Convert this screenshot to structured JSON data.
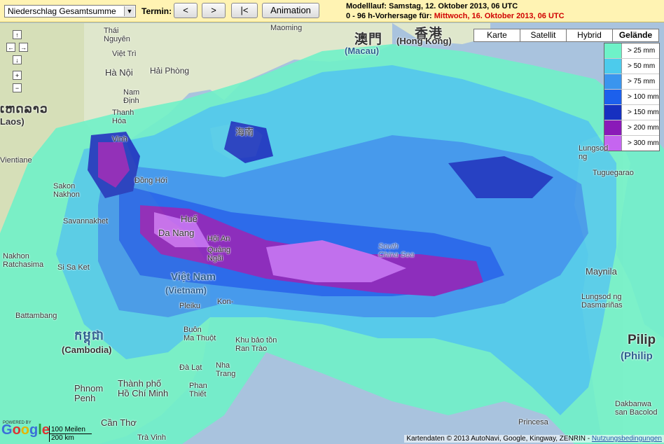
{
  "toolbar": {
    "select_value": "Niederschlag Gesamtsumme",
    "termin_label": "Termin:",
    "btn_prev": "<",
    "btn_next": ">",
    "btn_first": "|<",
    "btn_animation": "Animation",
    "model_run": "Modelllauf: Samstag, 12. Oktober 2013, 06 UTC",
    "forecast_prefix": "0 - 96 h-Vorhersage für: ",
    "forecast_date": "Mittwoch, 16. Oktober 2013, 06 UTC"
  },
  "map_types": [
    "Karte",
    "Satellit",
    "Hybrid",
    "Gelände"
  ],
  "legend": [
    {
      "label": "> 25 mm",
      "color": "#6ef2c8"
    },
    {
      "label": "> 50 mm",
      "color": "#4ccbec"
    },
    {
      "label": "> 75 mm",
      "color": "#3a95ee"
    },
    {
      "label": "> 100 mm",
      "color": "#1c60ec"
    },
    {
      "label": "> 150 mm",
      "color": "#1630c0"
    },
    {
      "label": "> 200 mm",
      "color": "#8a1ab8"
    },
    {
      "label": "> 300 mm",
      "color": "#c565f0"
    }
  ],
  "places": {
    "thai_nguyen": "Thái\nNguyên",
    "viet_tri": "Việt Trì",
    "ha_noi": "Hà Nội",
    "hai_phong": "Hải Phòng",
    "nam_dinh": "Nam\nĐịnh",
    "thanh_hoa": "Thanh\nHóa",
    "vinh": "Vinh",
    "dong_hoi": "Đồng Hới",
    "hue": "Huế",
    "da_nang": "Da Nang",
    "hoi_an": "Hội An",
    "quang_ngai": "Quảng\nNgãi",
    "kon_tum": "Kon-",
    "pleiku": "Pleiku",
    "buon_ma_thuot": "Buôn\nMa Thuột",
    "khu_bao_ton": "Khu bảo tồn\nRan Trào",
    "nha_trang": "Nha\nTrang",
    "da_lat": "Đà Lạt",
    "phan_thiet": "Phan\nThiết",
    "ho_chi_minh": "Thành phố\nHồ Chí Minh",
    "can_tho": "Cần Thơ",
    "tra_vinh": "Trà Vinh",
    "phnom_penh": "Phnom\nPenh",
    "battambang": "Battambang",
    "vientiane": "Vientiane",
    "sakon_nakhon": "Sakon\nNakhon",
    "savannakhet": "Savannakhet",
    "nakhon": "Nakhon\nRatchasima",
    "sisaket": "Si Sa Ket",
    "maoming": "Maoming",
    "macau_cn": "澳門",
    "macau": "(Macau)",
    "hongkong_cn": "香港",
    "hongkong": "(Hong Kong)",
    "hainan_cn": "海南",
    "south_china_sea": "South\nChina Sea",
    "lungsod": "Lungsod\nng",
    "tuguegarao": "Tuguegarao",
    "manila": "Maynila",
    "dasmarinas": "Lungsod ng\nDasmariñas",
    "dakbanwa": "Dakbanwa\nsan Bacolod",
    "princesa": "Princesa",
    "laos_big": "ເຫດລາວ",
    "laos": "Laos)",
    "vietnam_big": "Việt Nam",
    "vietnam": "(Vietnam)",
    "cambodia_big": "កម្ពុជា",
    "cambodia": "(Cambodia)",
    "phil": "Pilip",
    "phil2": "(Philip"
  },
  "scale": {
    "top": "100 Meilen",
    "bottom": "200 km"
  },
  "copyright": "Kartendaten © 2013 AutoNavi, Google, Kingway, ZENRIN - ",
  "copyright_link": "Nutzungsbedingungen",
  "powered": "POWERED BY",
  "google": "Google"
}
